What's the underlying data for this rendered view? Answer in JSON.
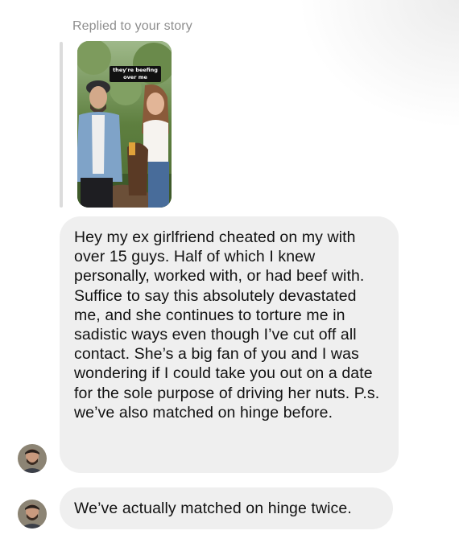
{
  "reply_context": {
    "label": "Replied to your story",
    "story_caption": "they're beefing over me"
  },
  "messages": [
    {
      "text": "Hey my ex girlfriend cheated on my with over 15 guys. Half of which I knew personally, worked with, or had beef with.  Suffice to say this absolutely devastated me, and she continues to torture me in sadistic ways even though I’ve cut off all contact.  She’s a big fan of you and I was wondering if I could take you out on a date for the sole purpose of driving her nuts. P.s. we’ve also matched on hinge before."
    },
    {
      "text": "We’ve actually matched on hinge twice."
    }
  ],
  "colors": {
    "bubble_background": "#efefef",
    "label_gray": "#8e8e8e",
    "reply_bar": "#dcdcdc"
  }
}
